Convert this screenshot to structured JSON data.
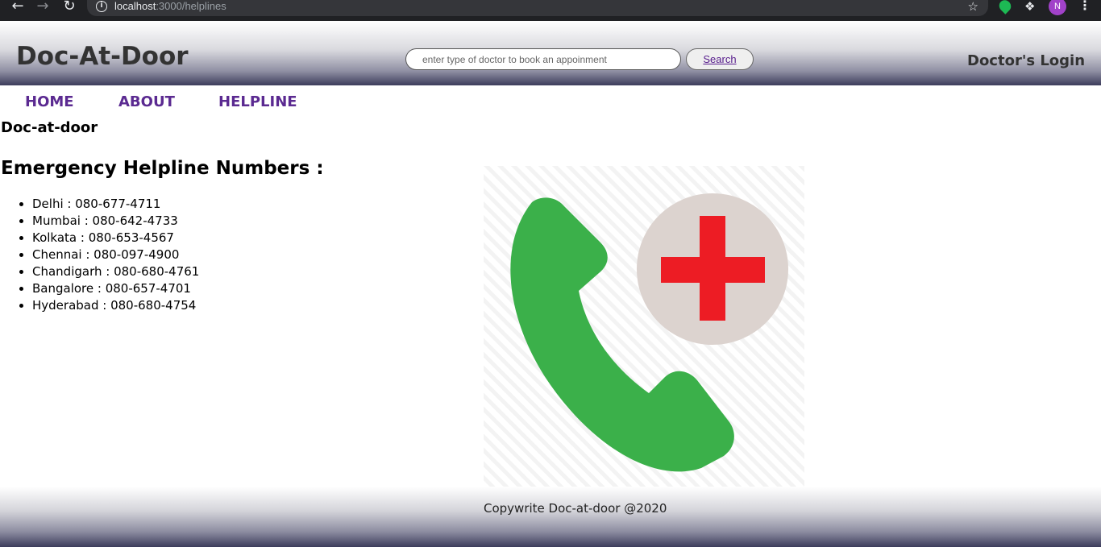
{
  "browser": {
    "url_host": "localhost",
    "url_rest": ":3000/helplines",
    "profile_initial": "N",
    "back_icon": "back-arrow-icon",
    "forward_icon": "forward-arrow-icon",
    "reload_icon": "reload-icon",
    "info_icon": "info-icon",
    "star_icon": "bookmark-star-icon",
    "extension_icon": "puzzle-icon"
  },
  "header": {
    "brand": "Doc-At-Door",
    "search_placeholder": "enter type of doctor to book an appoinment",
    "search_value": "",
    "search_button": "Search",
    "doctor_login": "Doctor's Login"
  },
  "nav": {
    "home": "HOME",
    "about": "ABOUT",
    "helpline": "HELPLINE"
  },
  "site_name": "Doc-at-door",
  "emergency": {
    "heading": "Emergency Helpline Numbers :",
    "items": [
      "Delhi : 080-677-4711",
      "Mumbai : 080-642-4733",
      "Kolkata : 080-653-4567",
      "Chennai : 080-097-4900",
      "Chandigarh : 080-680-4761",
      "Bangalore : 080-657-4701",
      "Hyderabad : 080-680-4754"
    ]
  },
  "image": {
    "icon": "emergency-phone-icon",
    "colors": {
      "phone": "#3bb04a",
      "circle": "#dcd3cf",
      "cross": "#ed1c24"
    }
  },
  "footer": {
    "text": "Copywrite Doc-at-door @2020"
  },
  "colors": {
    "nav_link": "#5b2a91",
    "brand_text": "#333333",
    "header_gradient_dark": "#3d3d5c"
  }
}
